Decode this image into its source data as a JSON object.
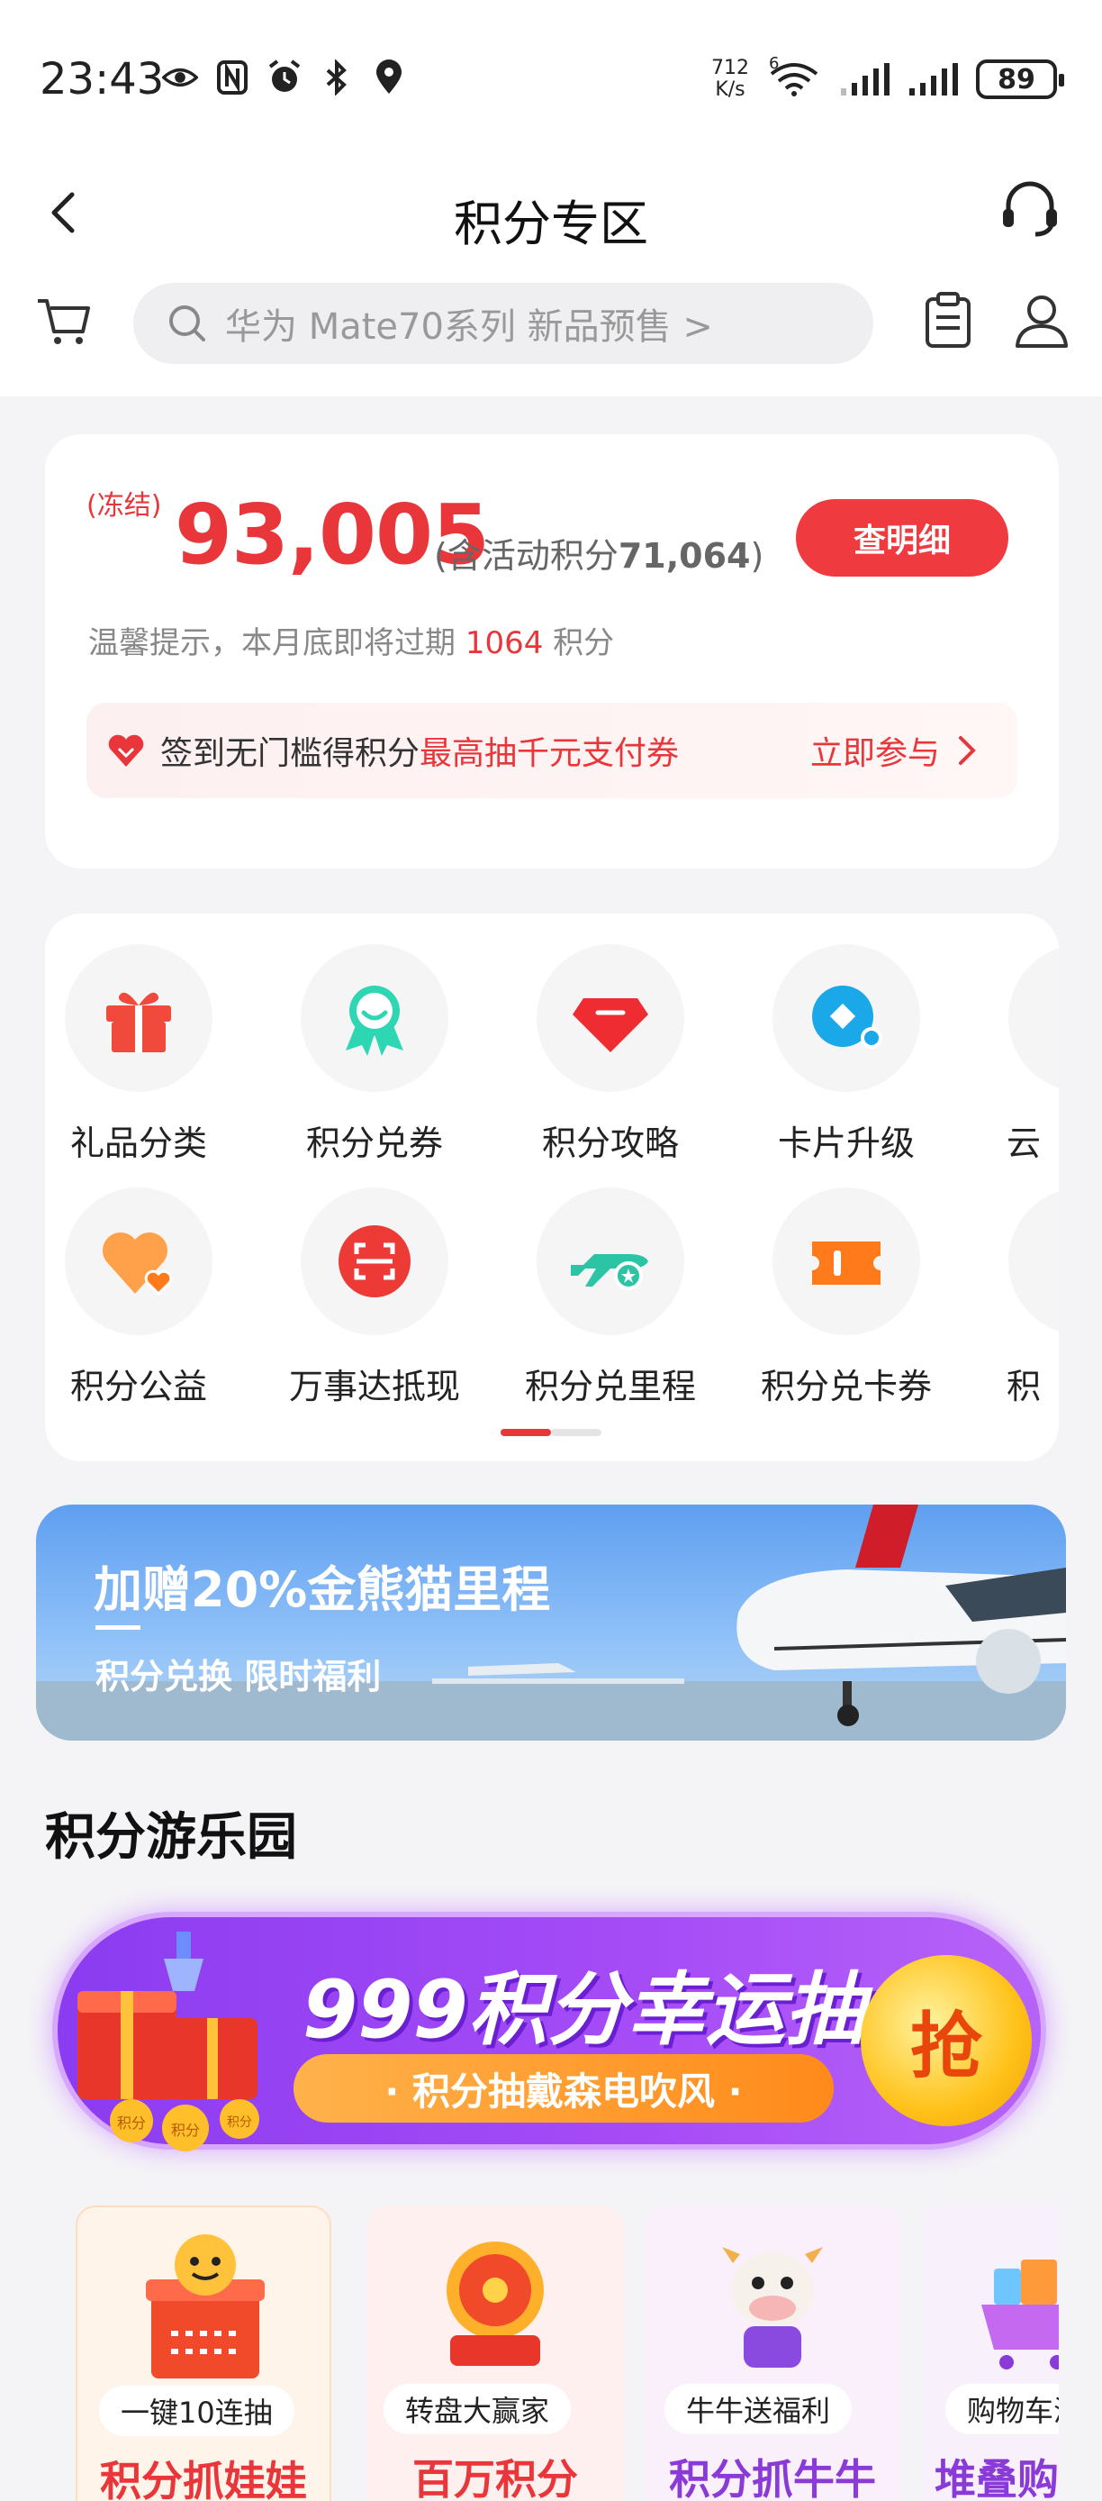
{
  "status_bar": {
    "time": "23:43",
    "net_speed_value": "712",
    "net_speed_unit": "K/s",
    "wifi_label": "6",
    "battery": "89"
  },
  "header": {
    "title": "积分专区",
    "search_placeholder": "华为 Mate70系列 新品预售 >"
  },
  "points": {
    "frozen_label": "(冻结)",
    "total": "93,005",
    "activity_prefix": "(含活动积分",
    "activity_value": "71,064",
    "activity_suffix": ")",
    "detail_button": "查明细",
    "tip_prefix": "温馨提示，本月底即将过期 ",
    "tip_value": "1064",
    "tip_suffix": " 积分",
    "signin_text": "签到无门槛得积分",
    "signin_highlight": "最高抽千元支付券",
    "signin_action": "立即参与"
  },
  "categories": [
    {
      "label": "礼品分类",
      "icon": "gift-icon"
    },
    {
      "label": "积分兑券",
      "icon": "badge-icon"
    },
    {
      "label": "积分攻略",
      "icon": "gem-icon"
    },
    {
      "label": "卡片升级",
      "icon": "card-icon"
    },
    {
      "label": "云",
      "icon": "cloud-icon"
    },
    {
      "label": "积分公益",
      "icon": "heart-icon"
    },
    {
      "label": "万事达抵现",
      "icon": "scan-icon"
    },
    {
      "label": "积分兑里程",
      "icon": "plane-icon"
    },
    {
      "label": "积分兑卡券",
      "icon": "ticket-icon"
    },
    {
      "label": "积",
      "icon": "more-icon"
    }
  ],
  "banner": {
    "title": "加赠20%金熊猫里程",
    "subtitle": "积分兑换 限时福利"
  },
  "section": {
    "title": "积分游乐园"
  },
  "lucky_draw": {
    "title": "999积分幸运抽",
    "subtitle": "· 积分抽戴森电吹风 ·",
    "grab": "抢",
    "coin_labels": [
      "积分",
      "积分",
      "积分"
    ]
  },
  "games": [
    {
      "tag": "一键10连抽",
      "name": "积分抓娃娃",
      "color": "#e8363a"
    },
    {
      "tag": "转盘大赢家",
      "name": "百万积分",
      "color": "#e8363a"
    },
    {
      "tag": "牛牛送福利",
      "name": "积分抓牛牛",
      "color": "#8a3ad6"
    },
    {
      "tag": "购物车满",
      "name": "堆叠购",
      "color": "#8a3ad6"
    }
  ],
  "colors": {
    "accent": "#e8363a",
    "purple": "#8b3cf0"
  }
}
